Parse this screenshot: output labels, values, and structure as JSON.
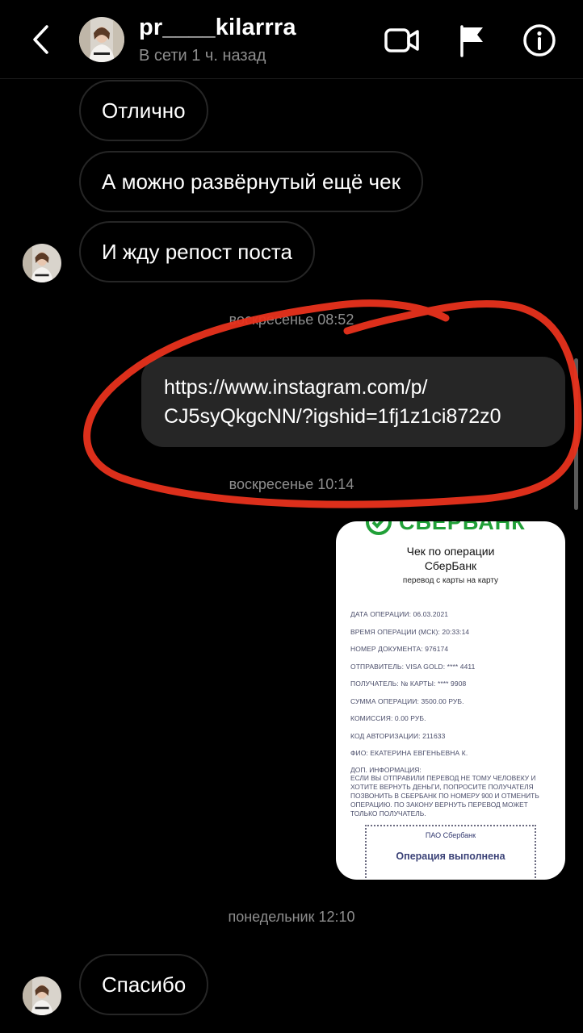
{
  "header": {
    "username": "pr____kilarrra",
    "status": "В сети 1 ч. назад"
  },
  "messages": {
    "m1": "Отлично",
    "m2": "А можно развёрнутый ещё чек",
    "m3": "И жду репост поста",
    "ts1": "воскресенье 08:52",
    "link_line1": "https://www.instagram.com/p/",
    "link_line2": "CJ5syQkgcNN/?igshid=1fj1z1ci872z0",
    "ts2": "воскресенье 10:14",
    "ts3": "понедельник 12:10",
    "m4": "Спасибо"
  },
  "receipt": {
    "logo": "СБЕРБАНК",
    "title_line1": "Чек по операции",
    "title_line2": "СберБанк",
    "subtitle": "перевод с карты на карту",
    "fields": [
      "ДАТА ОПЕРАЦИИ: 06.03.2021",
      "ВРЕМЯ ОПЕРАЦИИ (МСК): 20:33:14",
      "НОМЕР ДОКУМЕНТА: 976174",
      "ОТПРАВИТЕЛЬ: VISA GOLD: **** 4411",
      "ПОЛУЧАТЕЛЬ: № КАРТЫ: **** 9908",
      "СУММА ОПЕРАЦИИ: 3500.00 РУБ.",
      "КОМИССИЯ: 0.00 РУБ.",
      "КОД АВТОРИЗАЦИИ: 211633",
      "ФИО: ЕКАТЕРИНА ЕВГЕНЬЕВНА К."
    ],
    "info_label": "ДОП. ИНФОРМАЦИЯ:",
    "info_text": "ЕСЛИ ВЫ ОТПРАВИЛИ ПЕРЕВОД НЕ ТОМУ ЧЕЛОВЕКУ И ХОТИТЕ ВЕРНУТЬ ДЕНЬГИ, ПОПРОСИТЕ ПОЛУЧАТЕЛЯ ПОЗВОНИТЬ В СБЕРБАНК ПО НОМЕРУ 900 И ОТМЕНИТЬ ОПЕРАЦИЮ. ПО ЗАКОНУ ВЕРНУТЬ ПЕРЕВОД МОЖЕТ ТОЛЬКО ПОЛУЧАТЕЛЬ.",
    "bank": "ПАО Сбербанк",
    "status": "Операция выполнена"
  },
  "icons": [
    "back-icon",
    "video-call-icon",
    "flag-icon",
    "info-icon"
  ],
  "colors": {
    "background": "#000000",
    "bubble_border": "#262626",
    "bubble_out": "#262626",
    "secondary_text": "#8e8e8e",
    "annotation_red": "#e8311c",
    "sber_green": "#21a038"
  }
}
